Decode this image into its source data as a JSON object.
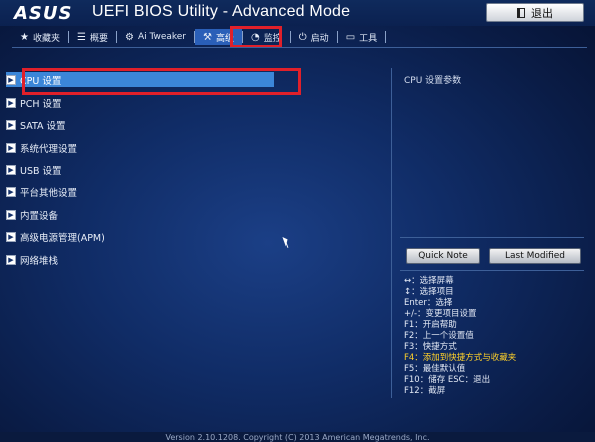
{
  "header": {
    "logo": "ASUS",
    "title": "UEFI BIOS Utility - Advanced Mode",
    "exit_label": "退出"
  },
  "nav": {
    "tabs": [
      {
        "label": "收藏夹",
        "icon": "star-icon"
      },
      {
        "label": "概要",
        "icon": "list-icon"
      },
      {
        "label": "Ai Tweaker",
        "icon": "ai-tweaker-icon"
      },
      {
        "label": "高级",
        "icon": "advanced-icon",
        "active": true
      },
      {
        "label": "监控",
        "icon": "monitor-icon"
      },
      {
        "label": "启动",
        "icon": "power-icon"
      },
      {
        "label": "工具",
        "icon": "tool-icon"
      }
    ]
  },
  "menu": {
    "items": [
      {
        "label": "CPU 设置",
        "selected": true
      },
      {
        "label": "PCH 设置"
      },
      {
        "label": "SATA 设置"
      },
      {
        "label": "系统代理设置"
      },
      {
        "label": "USB 设置"
      },
      {
        "label": "平台其他设置"
      },
      {
        "label": "内置设备"
      },
      {
        "label": "高级电源管理(APM)"
      },
      {
        "label": "网络堆栈"
      }
    ]
  },
  "help": {
    "title": "CPU 设置参数",
    "quick_note": "Quick Note",
    "last_modified": "Last Modified",
    "keys": [
      {
        "text": "↔：选择屏幕"
      },
      {
        "text": "↕：选择项目"
      },
      {
        "text": "Enter：选择"
      },
      {
        "text": "+/-：变更项目设置"
      },
      {
        "text": "F1：开启帮助"
      },
      {
        "text": "F2：上一个设置值"
      },
      {
        "text": "F3：快捷方式"
      },
      {
        "text": "F4：添加到快捷方式与收藏夹",
        "highlight": true
      },
      {
        "text": "F5：最佳默认值"
      },
      {
        "text": "F10：储存  ESC：退出"
      },
      {
        "text": "F12：截屏"
      }
    ]
  },
  "footer": {
    "version": "Version 2.10.1208. Copyright (C) 2013 American Megatrends, Inc."
  },
  "colors": {
    "background": "#102c66",
    "selected": "#3b86d8",
    "highlight_box": "#e0202a",
    "key_highlight": "#ffd12a"
  }
}
